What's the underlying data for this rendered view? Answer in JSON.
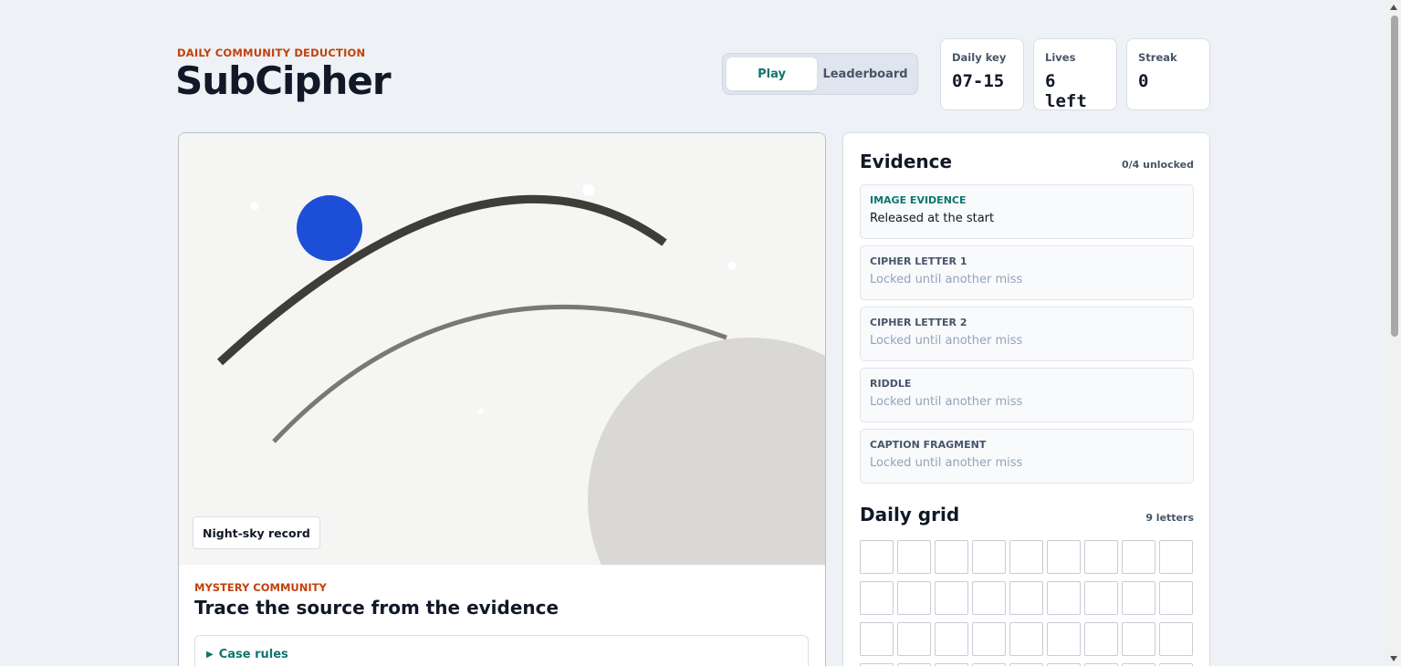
{
  "header": {
    "eyebrow": "DAILY COMMUNITY DEDUCTION",
    "title": "SubCipher"
  },
  "tabs": [
    {
      "label": "Play",
      "active": true
    },
    {
      "label": "Leaderboard",
      "active": false
    }
  ],
  "stats": [
    {
      "label": "Daily key",
      "value": "07-15"
    },
    {
      "label": "Lives",
      "value": "6 left"
    },
    {
      "label": "Streak",
      "value": "0"
    }
  ],
  "artwork": {
    "caption": "Night-sky record",
    "colors": {
      "background": "#f5f5f3",
      "planet": "#1d4ed8",
      "arc_dark": "#3f3d38",
      "arc_light": "#7a7875",
      "moon": "#d9d8d5",
      "stars": "#ffffff"
    }
  },
  "mystery": {
    "label": "MYSTERY COMMUNITY",
    "title": "Trace the source from the evidence",
    "rules_label": "Case rules"
  },
  "evidence": {
    "title": "Evidence",
    "meta": "0/4 unlocked",
    "items": [
      {
        "type": "IMAGE EVIDENCE",
        "text": "Released at the start",
        "unlocked": true
      },
      {
        "type": "CIPHER LETTER 1",
        "text": "Locked until another miss",
        "unlocked": false
      },
      {
        "type": "CIPHER LETTER 2",
        "text": "Locked until another miss",
        "unlocked": false
      },
      {
        "type": "RIDDLE",
        "text": "Locked until another miss",
        "unlocked": false
      },
      {
        "type": "CAPTION FRAGMENT",
        "text": "Locked until another miss",
        "unlocked": false
      }
    ]
  },
  "daily_grid": {
    "title": "Daily grid",
    "meta": "9 letters",
    "columns": 9,
    "visible_rows": 4
  },
  "colors": {
    "accent": "#0f766e",
    "eyebrow": "#c2410c",
    "page_bg": "#eef1f5"
  }
}
